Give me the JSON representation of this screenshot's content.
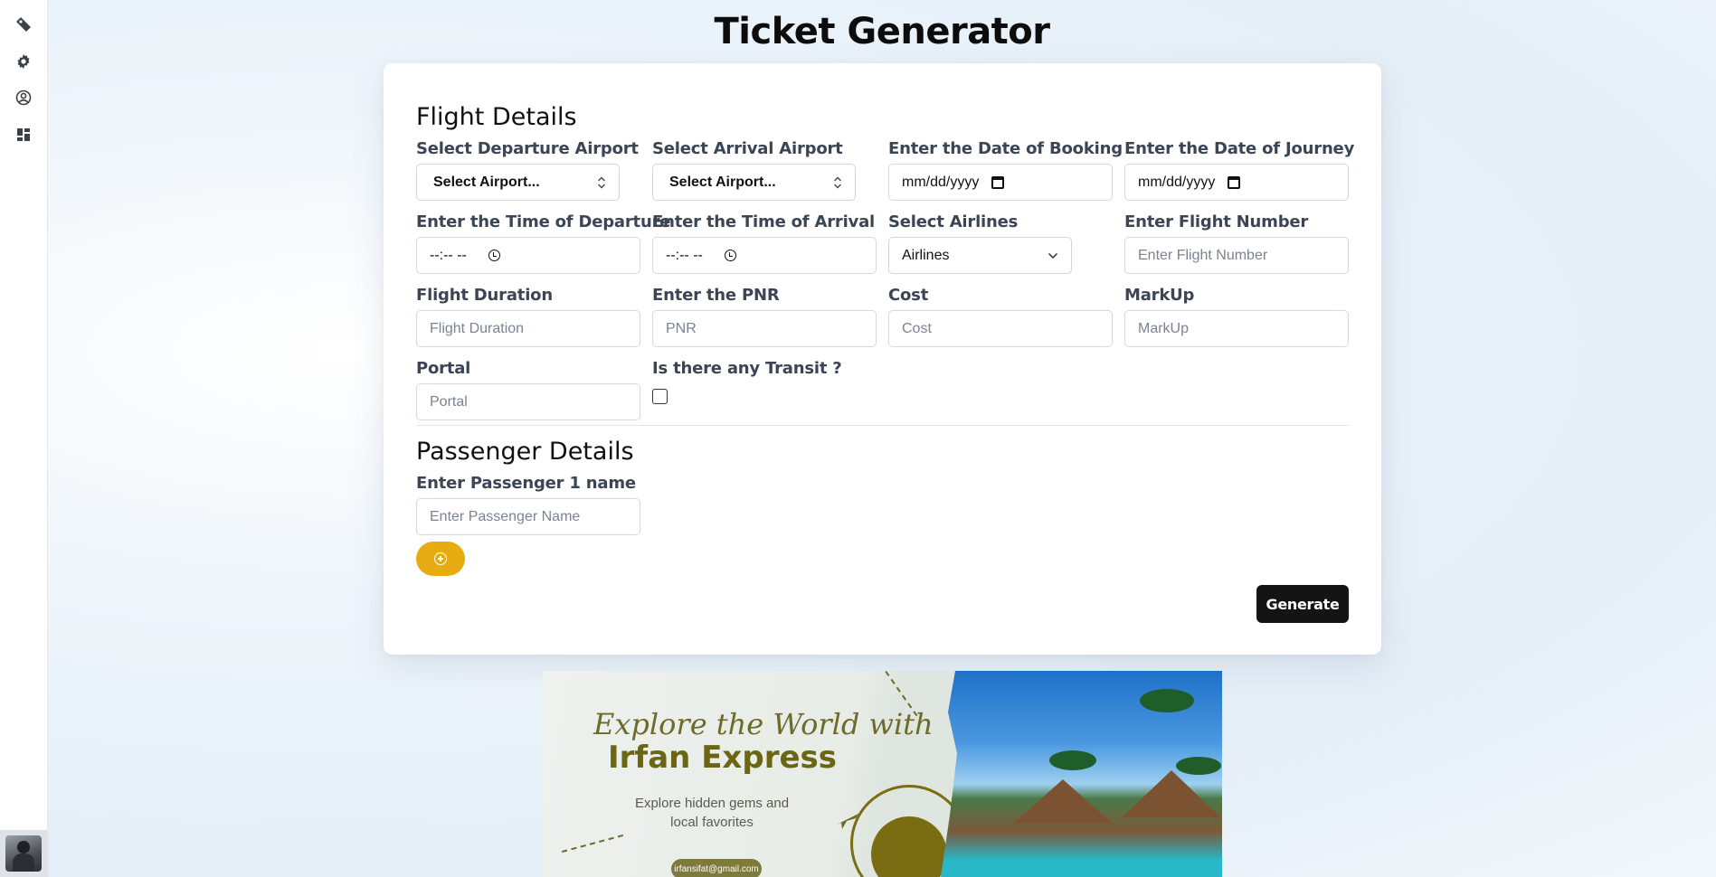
{
  "sidebar": {
    "items": [
      {
        "icon": "ticket-icon"
      },
      {
        "icon": "gear-icon"
      },
      {
        "icon": "user-circle-icon"
      },
      {
        "icon": "dashboard-icon"
      }
    ],
    "avatar": "avatar"
  },
  "page": {
    "title": "Ticket Generator"
  },
  "flight": {
    "title": "Flight Details",
    "departure": {
      "label": "Select Departure Airport",
      "value": "Select Airport..."
    },
    "arrival": {
      "label": "Select Arrival Airport",
      "value": "Select Airport..."
    },
    "booking_date": {
      "label": "Enter the Date of Booking",
      "value": "mm/dd/yyyy"
    },
    "journey_date": {
      "label": "Enter the Date of Journey",
      "value": "mm/dd/yyyy"
    },
    "departure_time": {
      "label": "Enter the Time of Departure",
      "value": "--:-- --"
    },
    "arrival_time": {
      "label": "Enter the Time of Arrival",
      "value": "--:-- --"
    },
    "airlines": {
      "label": "Select Airlines",
      "value": "Airlines"
    },
    "flight_number": {
      "label": "Enter Flight Number",
      "placeholder": "Enter Flight Number"
    },
    "duration": {
      "label": "Flight Duration",
      "placeholder": "Flight Duration"
    },
    "pnr": {
      "label": "Enter the PNR",
      "placeholder": "PNR"
    },
    "cost": {
      "label": "Cost",
      "placeholder": "Cost"
    },
    "markup": {
      "label": "MarkUp",
      "placeholder": "MarkUp"
    },
    "portal": {
      "label": "Portal",
      "placeholder": "Portal"
    },
    "transit": {
      "label": "Is there any Transit ?",
      "checked": false
    }
  },
  "passenger": {
    "title": "Passenger Details",
    "name": {
      "label": "Enter Passenger 1 name",
      "placeholder": "Enter Passenger Name"
    },
    "add_icon": "plus-circle-icon"
  },
  "actions": {
    "generate": "Generate"
  },
  "banner": {
    "script": "Explore the World with",
    "brand": "Irfan Express",
    "sub": "Explore hidden gems and local favorites",
    "email": "irfansifat@gmail.com"
  },
  "colors": {
    "accent": "#e7ac12",
    "primary_button": "#141414",
    "label": "#3b4554"
  }
}
